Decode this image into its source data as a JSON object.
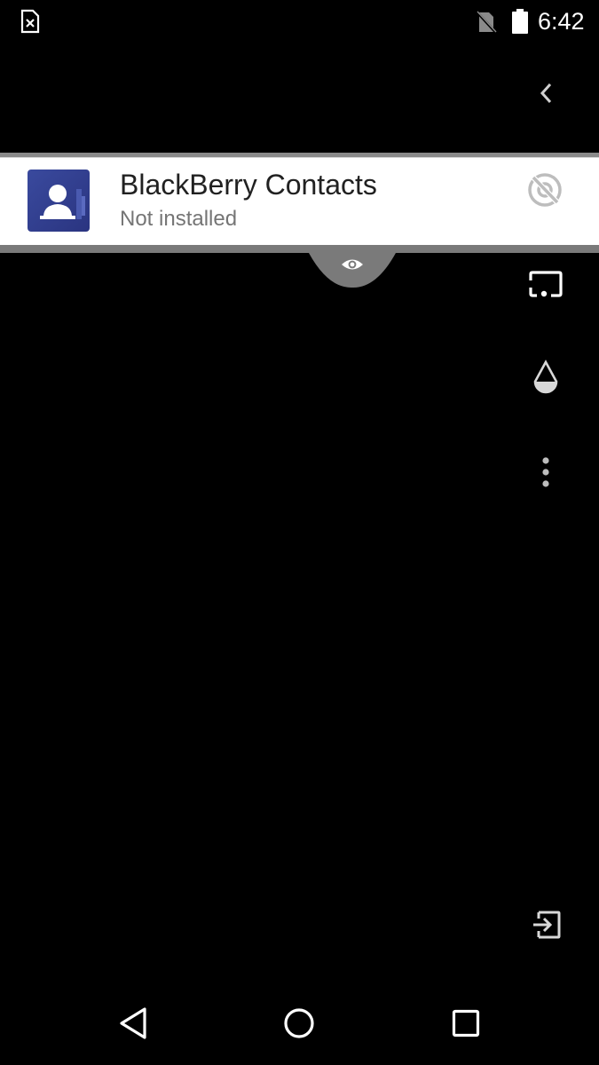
{
  "status_bar": {
    "time": "6:42",
    "icons": [
      "sim-error-icon",
      "no-sim-icon",
      "battery-full-icon"
    ]
  },
  "side_toolbar": {
    "items": [
      "back-chevron-icon",
      "cast-icon",
      "drop-icon",
      "more-vert-icon",
      "exit-icon"
    ]
  },
  "app_card": {
    "title": "BlackBerry Contacts",
    "subtitle": "Not installed",
    "icon": "contacts-app-icon",
    "action_icon": "visibility-off-icon"
  },
  "panel_handle": {
    "icon": "eye-icon"
  },
  "nav_bar": {
    "items": [
      "back-triangle-icon",
      "home-circle-icon",
      "recents-square-icon"
    ]
  },
  "colors": {
    "background": "#000000",
    "card": "#ffffff",
    "title": "#212121",
    "subtitle": "#757575",
    "app_icon": "#2f3b8f",
    "handle": "#8a8a8a"
  }
}
